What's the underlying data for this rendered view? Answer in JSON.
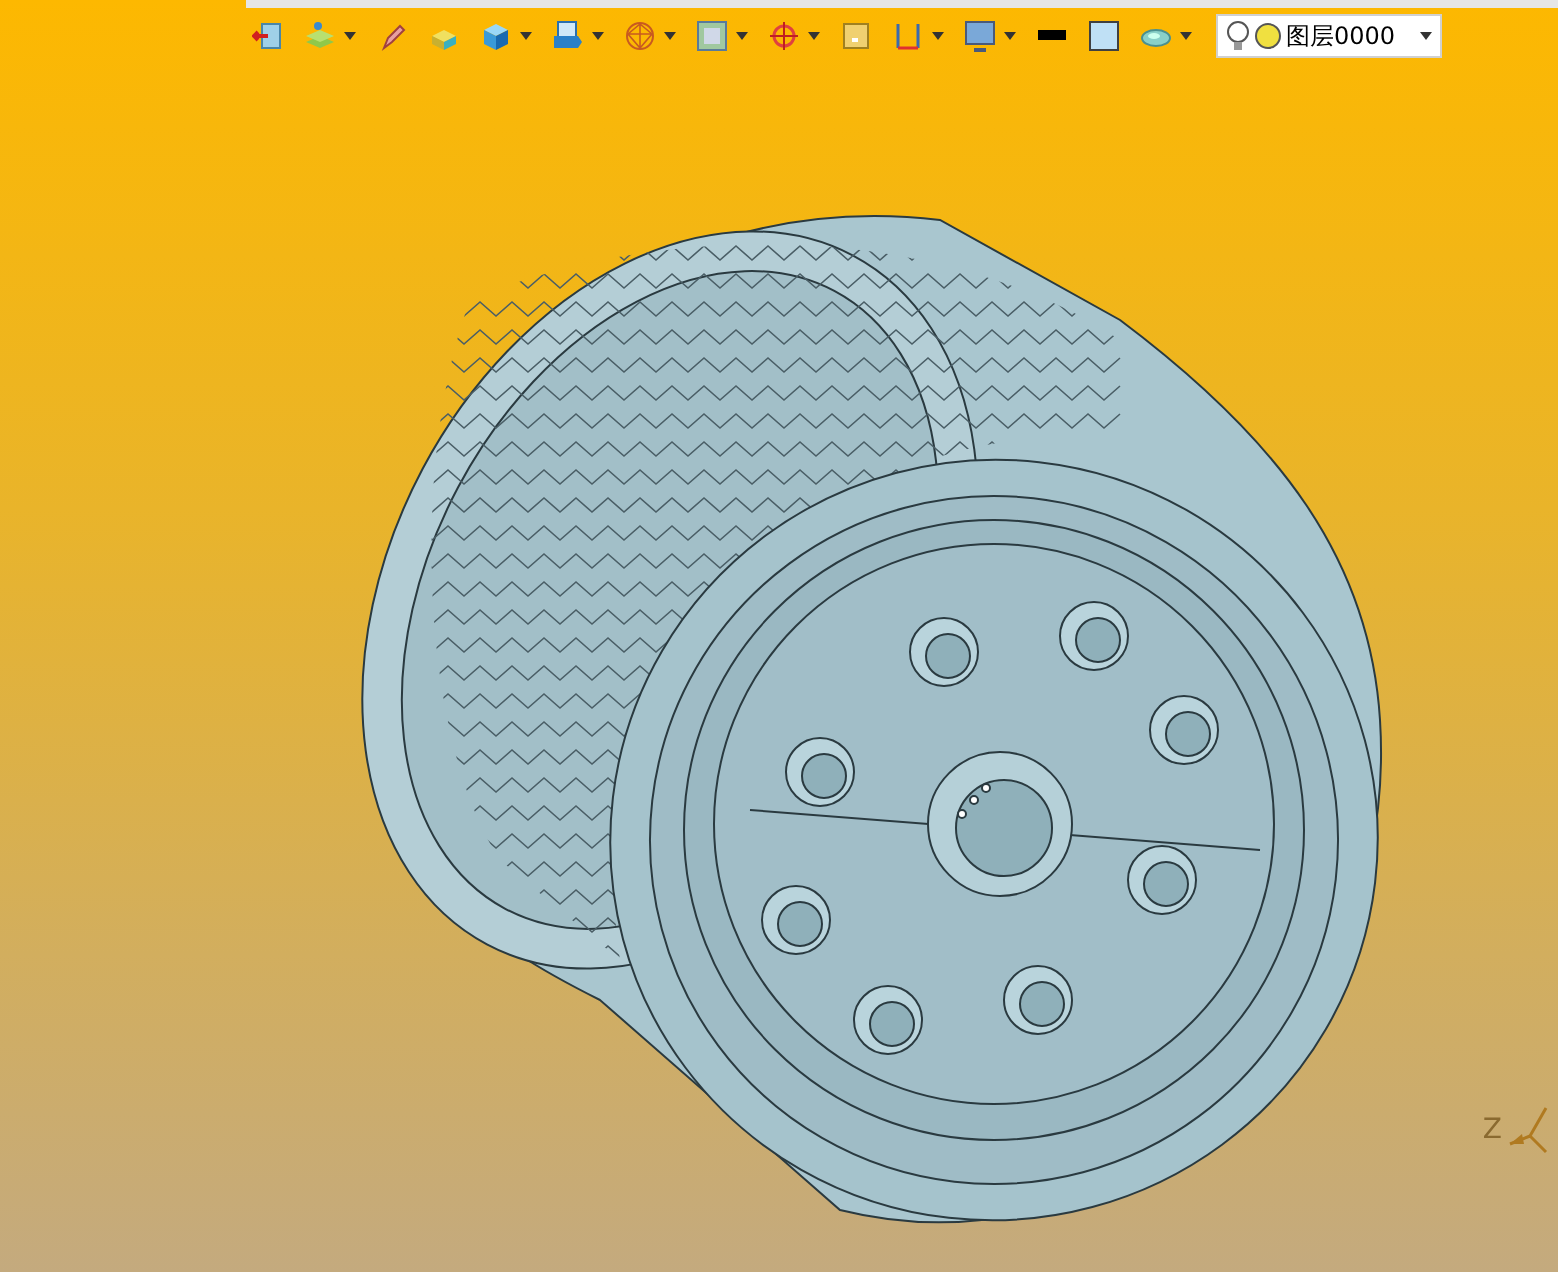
{
  "toolbar": {
    "tools": [
      {
        "kind": "exit",
        "dropdown": false
      },
      {
        "kind": "layers",
        "dropdown": true
      },
      {
        "kind": "pen",
        "dropdown": false
      },
      {
        "kind": "box",
        "dropdown": false
      },
      {
        "kind": "cube",
        "dropdown": true
      },
      {
        "kind": "view",
        "dropdown": true
      },
      {
        "kind": "sphere",
        "dropdown": true
      },
      {
        "kind": "frame",
        "dropdown": true
      },
      {
        "kind": "target",
        "dropdown": true
      },
      {
        "kind": "square",
        "dropdown": false
      },
      {
        "kind": "dimension",
        "dropdown": true
      },
      {
        "kind": "monitor",
        "dropdown": true
      },
      {
        "kind": "swatch",
        "dropdown": false,
        "color": "#000000"
      },
      {
        "kind": "swatch",
        "dropdown": false,
        "color": "#bfe0f5"
      },
      {
        "kind": "disc",
        "dropdown": true
      }
    ],
    "layer_select": {
      "value": "图层0000"
    }
  },
  "axis_triad": {
    "label": "Z"
  }
}
